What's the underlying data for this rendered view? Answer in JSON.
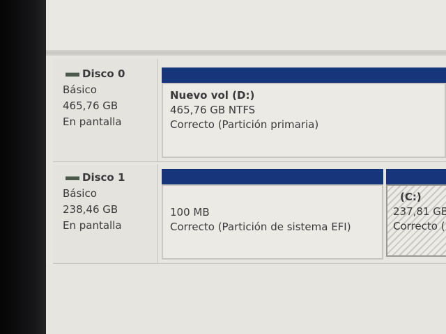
{
  "disks": [
    {
      "name": "Disco 0",
      "type": "Básico",
      "size": "465,76 GB",
      "status": "En pantalla",
      "partitions": [
        {
          "title": "Nuevo vol  (D:)",
          "info": "465,76 GB NTFS",
          "status": "Correcto (Partición primaria)"
        }
      ]
    },
    {
      "name": "Disco 1",
      "type": "Básico",
      "size": "238,46 GB",
      "status": "En pantalla",
      "partitions": [
        {
          "info": "100 MB",
          "status": "Correcto (Partición de sistema EFI)"
        },
        {
          "title": "(C:)",
          "info": "237,81 GB",
          "status": "Correcto ("
        }
      ]
    }
  ],
  "colors": {
    "partition_bar": "#17357a",
    "background": "#e7e6e1"
  }
}
